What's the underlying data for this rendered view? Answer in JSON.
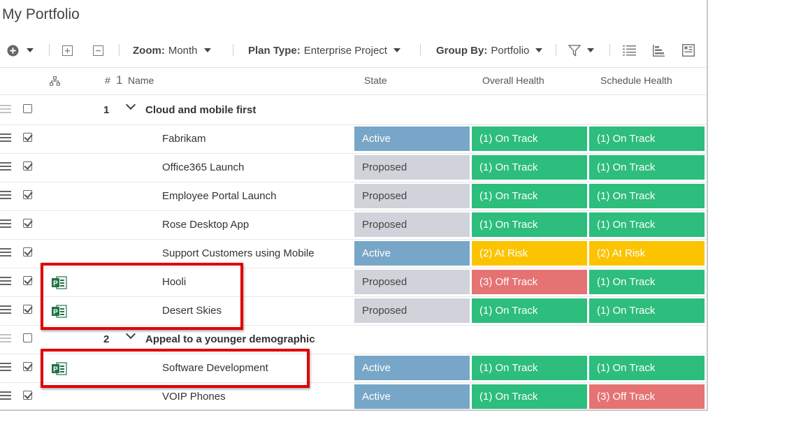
{
  "page": {
    "title": "My Portfolio"
  },
  "toolbar": {
    "zoom_label": "Zoom:",
    "zoom_value": "Month",
    "plan_type_label": "Plan Type:",
    "plan_type_value": "Enterprise Project",
    "group_by_label": "Group By:",
    "group_by_value": "Portfolio"
  },
  "columns": {
    "number": "#",
    "sort_indicator": "1",
    "name": "Name",
    "state": "State",
    "overall": "Overall Health",
    "schedule": "Schedule Health"
  },
  "colors": {
    "active": "#78a6c8",
    "proposed": "#d0d3da",
    "on_track": "#2dbd7d",
    "at_risk": "#fbc300",
    "off_track": "#e57373",
    "project_icon": "#217346",
    "highlight": "#e00000"
  },
  "groups": [
    {
      "number": "1",
      "name": "Cloud and mobile first"
    },
    {
      "number": "2",
      "name": "Appeal to a younger demographic"
    }
  ],
  "rows": [
    {
      "name": "Fabrikam",
      "state": "Active",
      "overall": "(1) On Track",
      "schedule": "(1) On Track",
      "project_icon": "none"
    },
    {
      "name": "Office365 Launch",
      "state": "Proposed",
      "overall": "(1) On Track",
      "schedule": "(1) On Track",
      "project_icon": "none"
    },
    {
      "name": "Employee Portal Launch",
      "state": "Proposed",
      "overall": "(1) On Track",
      "schedule": "(1) On Track",
      "project_icon": "none"
    },
    {
      "name": "Rose Desktop App",
      "state": "Proposed",
      "overall": "(1) On Track",
      "schedule": "(1) On Track",
      "project_icon": "none"
    },
    {
      "name": "Support Customers using Mobile",
      "state": "Active",
      "overall": "(2) At Risk",
      "schedule": "(2) At Risk",
      "project_icon": "none"
    },
    {
      "name": "Hooli",
      "state": "Proposed",
      "overall": "(3) Off Track",
      "schedule": "(1) On Track",
      "project_icon": "project-icon"
    },
    {
      "name": "Desert Skies",
      "state": "Proposed",
      "overall": "(1) On Track",
      "schedule": "(1) On Track",
      "project_icon": "project-icon"
    },
    {
      "name": "Software Development",
      "state": "Active",
      "overall": "(1) On Track",
      "schedule": "(1) On Track",
      "project_icon": "project-icon"
    },
    {
      "name": "VOIP Phones",
      "state": "Active",
      "overall": "(1) On Track",
      "schedule": "(3) Off Track",
      "project_icon": "none"
    }
  ]
}
